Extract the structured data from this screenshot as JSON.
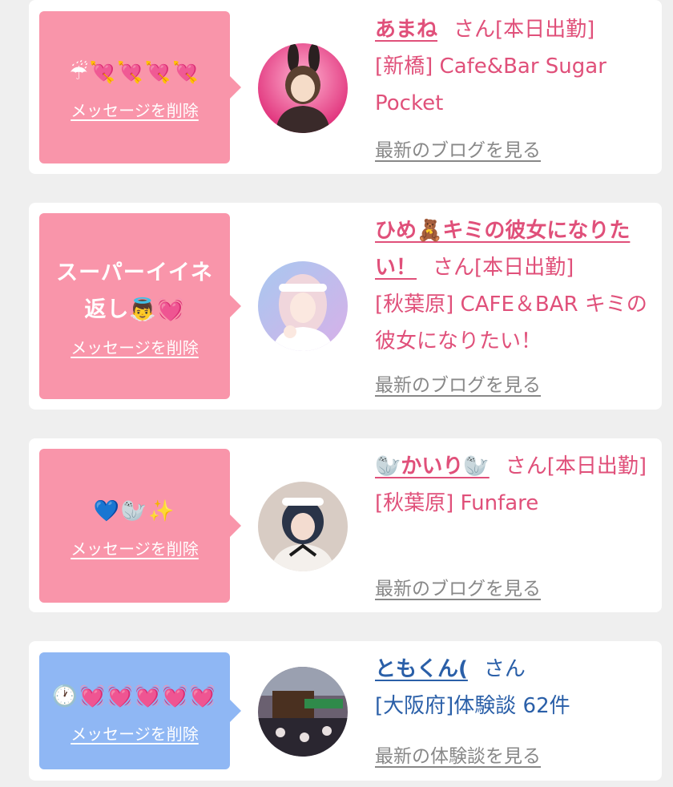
{
  "colors": {
    "pink_bubble": "#f995aa",
    "blue_bubble": "#8fb7f4",
    "pink_text": "#e0507a",
    "blue_text": "#2a5fa8",
    "link_gray": "#888888"
  },
  "delete_label": "メッセージを削除",
  "entries": [
    {
      "message": "☔💘💘💘💘",
      "name": "あまね",
      "suffix": "さん[本日出勤]",
      "shop": "[新橋] Cafe&Bar Sugar Pocket",
      "blog_link": "最新のブログを見る",
      "avatar_icon": "avatar-photo"
    },
    {
      "message": "スーパーイイネ返し👼💓",
      "name": "ひめ🧸キミの彼女になりたい！",
      "suffix": "さん[本日出勤]",
      "shop": "[秋葉原] CAFE＆BAR キミの彼女になりたい！",
      "blog_link": "最新のブログを見る",
      "avatar_icon": "avatar-photo"
    },
    {
      "message": "💙🦭✨",
      "name": "🦭かいり🦭",
      "suffix": "さん[本日出勤]",
      "shop": "[秋葉原] Funfare",
      "blog_link": "最新のブログを見る",
      "avatar_icon": "avatar-photo"
    },
    {
      "message": "🕐💓💓💓💓💓",
      "name": "ともくん(",
      "suffix": "さん",
      "shop": "[大阪府]体験談 62件",
      "blog_link": "最新の体験談を見る",
      "avatar_icon": "avatar-photo"
    }
  ]
}
